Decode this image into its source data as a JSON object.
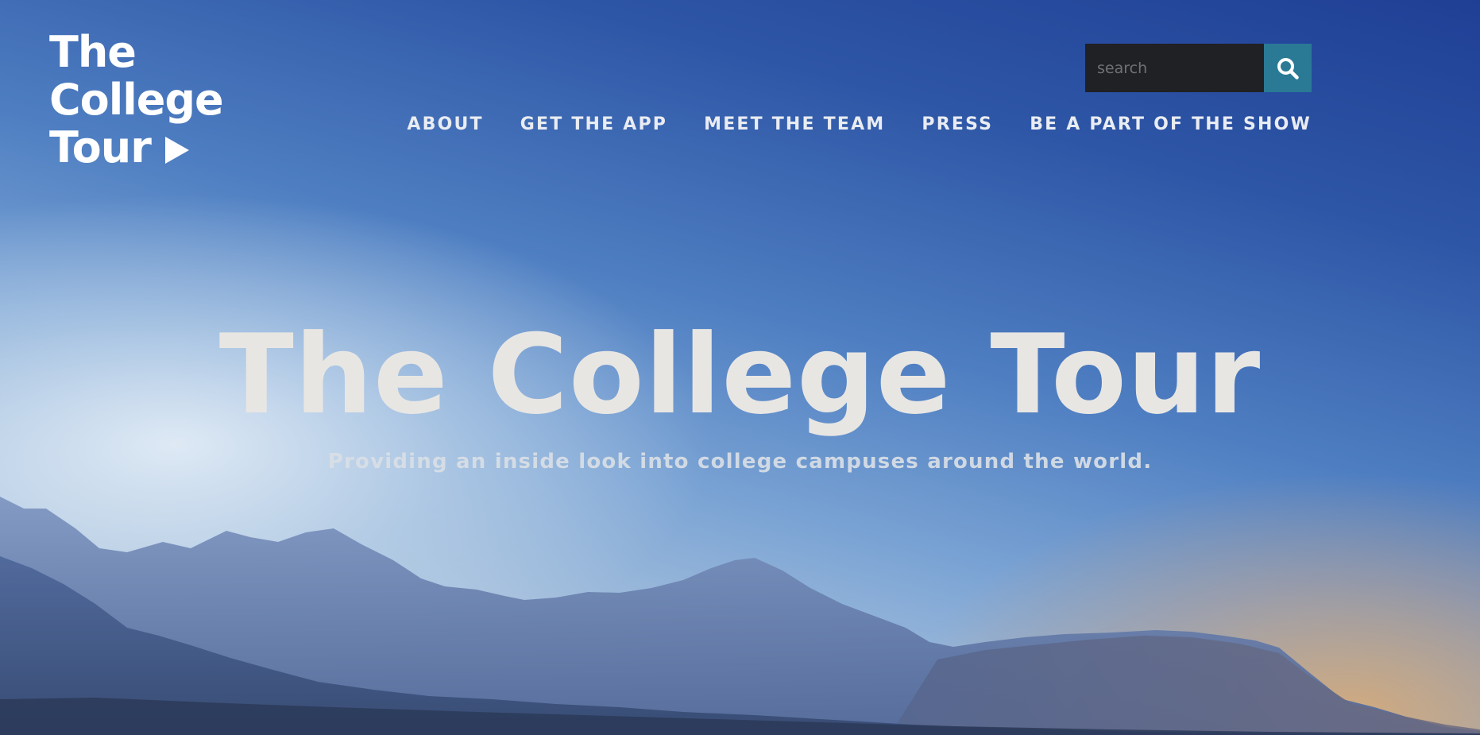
{
  "brand": {
    "logo_line_1": "The",
    "logo_line_2": "College",
    "logo_line_3": "Tour",
    "logo_icon": "play-icon"
  },
  "search": {
    "placeholder": "search",
    "button_icon": "search-icon",
    "input_background": "#202124",
    "button_color": "#2a7a95"
  },
  "nav": {
    "items": [
      {
        "label": "ABOUT"
      },
      {
        "label": "GET THE APP"
      },
      {
        "label": "MEET THE TEAM"
      },
      {
        "label": "PRESS"
      },
      {
        "label": "BE A PART OF THE SHOW"
      }
    ]
  },
  "hero": {
    "title": "The College Tour",
    "subtitle": "Providing an inside look into college campuses around the world.",
    "background": "mountain-range-at-dusk"
  }
}
